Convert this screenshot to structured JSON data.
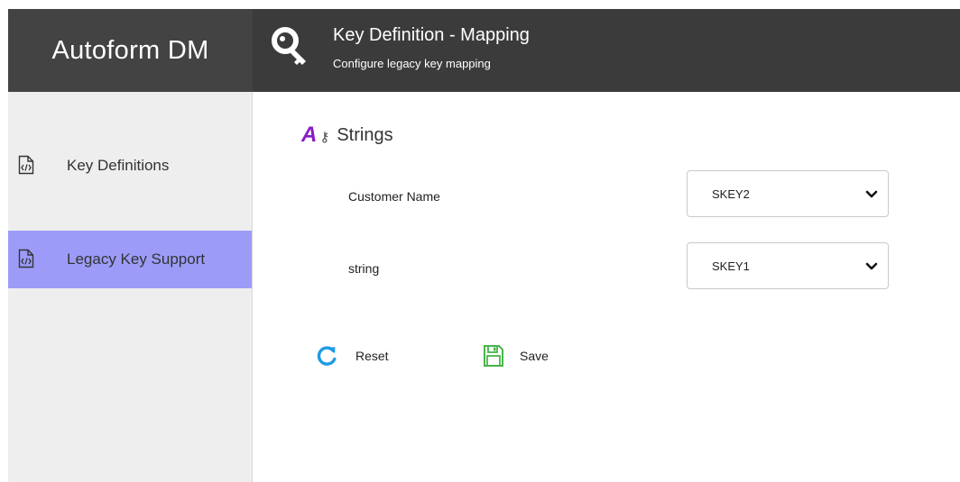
{
  "app": {
    "brand": "Autoform DM"
  },
  "header": {
    "title": "Key Definition - Mapping",
    "subtitle": "Configure legacy key mapping",
    "icon": "key-icon"
  },
  "sidebar": {
    "items": [
      {
        "label": "Key Definitions",
        "icon": "code-file-icon",
        "active": false
      },
      {
        "label": "Legacy Key Support",
        "icon": "code-file-icon",
        "active": true
      }
    ]
  },
  "section": {
    "title": "Strings",
    "icon_letter": "A",
    "icon_key": "⚷",
    "icon_color": "#8a1bc9"
  },
  "fields": [
    {
      "label": "Customer Name",
      "value": "SKEY2"
    },
    {
      "label": "string",
      "value": "SKEY1"
    }
  ],
  "actions": {
    "reset_label": "Reset",
    "save_label": "Save"
  },
  "colors": {
    "header_bg": "#3b3b3b",
    "sidebar_bg": "#eeeeee",
    "active_item_bg": "#9c9cf8",
    "reset_icon": "#1e9be8",
    "save_icon": "#49b54b"
  }
}
